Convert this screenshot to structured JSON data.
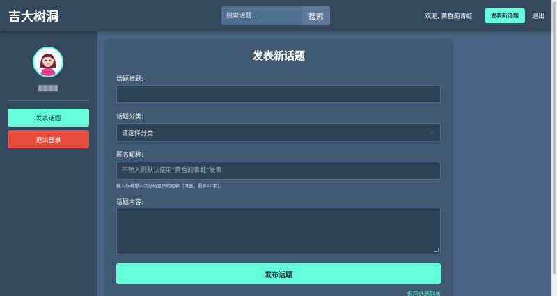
{
  "header": {
    "brand": "吉大树洞",
    "search": {
      "placeholder": "搜索话题...",
      "button_label": "搜索"
    },
    "welcome_text": "欢迎, 黄昏的青蛙",
    "new_topic_label": "发表新话题",
    "logout_label": "退出"
  },
  "sidebar": {
    "avatar_icon": "avatar-girl-icon",
    "username": "",
    "post_topic_label": "发表话题",
    "logout_label": "退出登录"
  },
  "form": {
    "title": "发表新话题",
    "topic_title_label": "话题标题:",
    "topic_title_value": "",
    "category_label": "话题分类:",
    "category_selected": "请选择分类",
    "nickname_label": "匿名昵称:",
    "nickname_placeholder": "不输入则默认使用\"黄昏的青蛙\"发表",
    "nickname_hint": "输入你希望本次发帖显示的昵称（可选，最多20字）。",
    "content_label": "话题内容:",
    "content_value": "",
    "submit_label": "发布话题",
    "back_link": "返回话题列表"
  },
  "colors": {
    "accent": "#64ffda",
    "danger": "#e74c3c",
    "header_bg": "#34495e",
    "card_bg": "#3f5973",
    "page_bg": "#4a6583"
  }
}
